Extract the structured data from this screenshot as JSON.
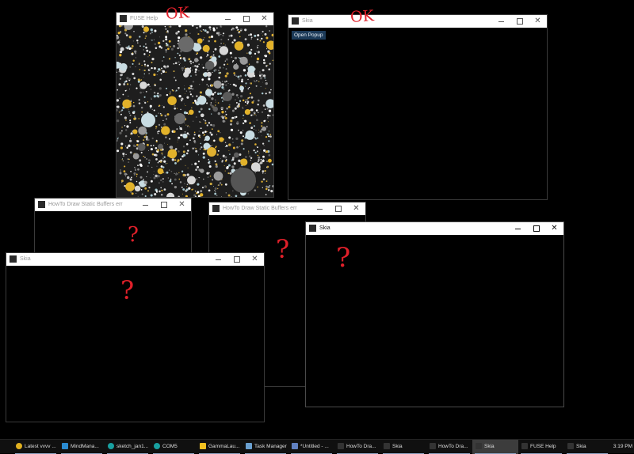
{
  "windows": {
    "fuse_help": {
      "title": "FUSE Help",
      "annotation": "OK"
    },
    "skia_popup": {
      "title": "Skia",
      "annotation": "OK",
      "button_label": "Open Popup"
    },
    "howto_1": {
      "title": "HowTo Draw Static Buffers err",
      "annotation": "?"
    },
    "howto_2": {
      "title": "HowTo Draw Static Buffers err",
      "annotation": "?"
    },
    "skia_left": {
      "title": "Skia",
      "annotation": "?"
    },
    "skia_right": {
      "title": "Skia",
      "annotation": "?"
    }
  },
  "title_controls": {
    "close": "✕"
  },
  "taskbar": {
    "items": [
      {
        "label": "Latest vvvv ...",
        "icon_color": "#e0b020"
      },
      {
        "label": "MindMana...",
        "icon_color": "#2a8ad0"
      },
      {
        "label": "sketch_jan1...",
        "icon_color": "#18a0a0"
      },
      {
        "label": "COM5",
        "icon_color": "#18a0a0"
      },
      {
        "label": "GammaLau...",
        "icon_color": "#f0c020"
      },
      {
        "label": "Task Manager",
        "icon_color": "#6aa0d0"
      },
      {
        "label": "*Untitled - ...",
        "icon_color": "#6080c0"
      },
      {
        "label": "HowTo Dra...",
        "icon_color": "#333333"
      },
      {
        "label": "Skia",
        "icon_color": "#333333"
      },
      {
        "label": "HowTo Dra...",
        "icon_color": "#333333"
      },
      {
        "label": "Skia",
        "icon_color": "#333333"
      },
      {
        "label": "FUSE Help",
        "icon_color": "#333333"
      },
      {
        "label": "Skia",
        "icon_color": "#333333"
      }
    ],
    "clock": "3:19 PM"
  },
  "colors": {
    "annotation": "#e0202a",
    "button_bg": "#1c3a58",
    "speckle_bg": "#1e1e1e"
  }
}
